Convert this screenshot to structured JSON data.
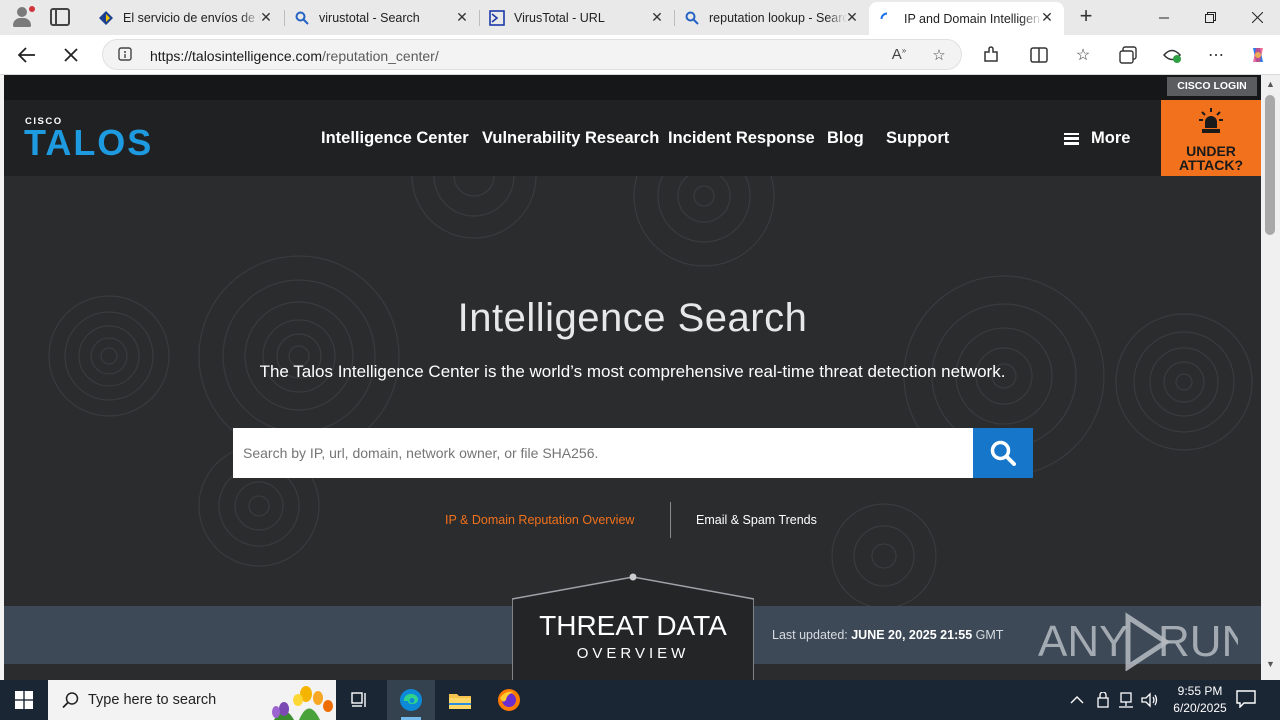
{
  "browser": {
    "tabs": [
      {
        "label": "El servicio de envíos de Correos",
        "icon": "correos-icon",
        "active": false
      },
      {
        "label": "virustotal - Search",
        "icon": "search-icon",
        "active": false
      },
      {
        "label": "VirusTotal - URL",
        "icon": "virustotal-icon",
        "active": false
      },
      {
        "label": "reputation lookup - Search",
        "icon": "search-icon",
        "active": false
      },
      {
        "label": "IP and Domain Intelligence Center",
        "icon": "loading-icon",
        "active": true
      }
    ],
    "url_host": "https://talosintelligence.com",
    "url_path": "/reputation_center/"
  },
  "page": {
    "cisco_login": "CISCO LOGIN",
    "logo_small": "CISCO",
    "logo_big": "TALOS",
    "nav": [
      "Intelligence Center",
      "Vulnerability Research",
      "Incident Response",
      "Blog",
      "Support"
    ],
    "more_label": "More",
    "under_attack_line1": "UNDER",
    "under_attack_line2": "ATTACK?",
    "hero_title": "Intelligence Search",
    "hero_subtitle": "The Talos Intelligence Center is the world’s most comprehensive real-time threat detection network.",
    "search_placeholder": "Search by IP, url, domain, network owner, or file SHA256.",
    "link_reputation": "IP & Domain Reputation Overview",
    "link_email": "Email & Spam Trends",
    "threat_title": "THREAT DATA",
    "threat_subtitle": "OVERVIEW",
    "last_updated_label": "Last updated: ",
    "last_updated_value": "JUNE 20, 2025 21:55",
    "last_updated_tz": " GMT",
    "watermark": "ANY RUN"
  },
  "taskbar": {
    "search_placeholder": "Type here to search",
    "time": "9:55 PM",
    "date": "6/20/2025"
  },
  "colors": {
    "accent_orange": "#f2711c",
    "talos_blue": "#1e9be0",
    "search_button": "#1676c9",
    "page_bg": "#2b2c2e"
  }
}
